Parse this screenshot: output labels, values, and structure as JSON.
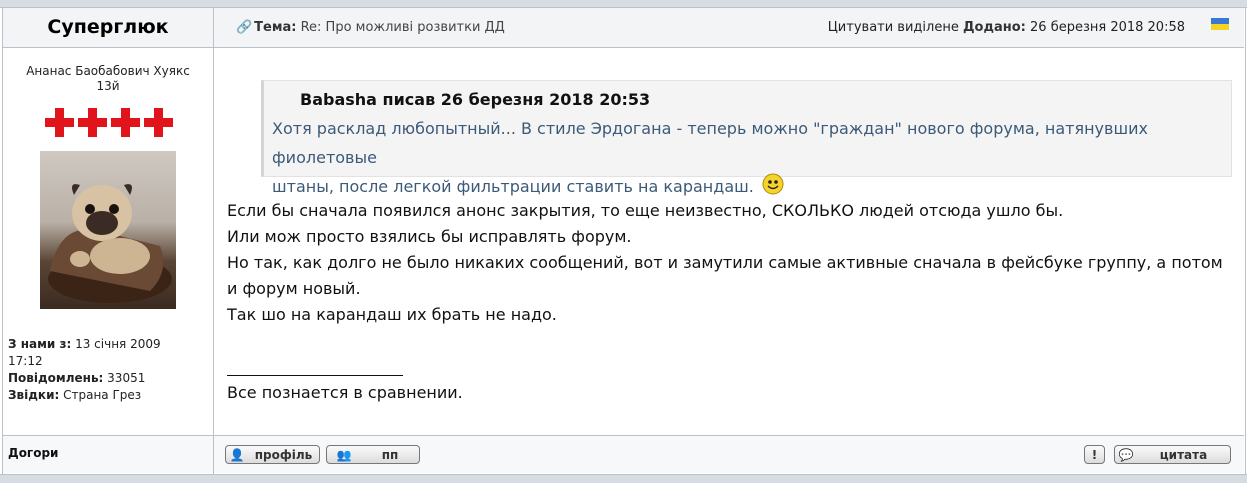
{
  "post": {
    "author_title": "Суперглюк",
    "topic_label": "Тема:",
    "topic_value": "Re: Про можливі розвитки ДД",
    "quote_selected": "Цитувати виділене",
    "added_label": "Додано:",
    "added_value": "26 березня 2018 20:58"
  },
  "user": {
    "name_line1": "Ананас Баобабович Хуякс",
    "name_line2": "13й",
    "joined_label": "З нами з:",
    "joined_value_line1": "13 січня 2009",
    "joined_value_line2": "17:12",
    "posts_label": "Повідомлень:",
    "posts_value": "33051",
    "from_label": "Звідки:",
    "from_value": "Страна Грез",
    "rank_icons": [
      "cross-icon",
      "cross-icon",
      "cross-icon",
      "cross-icon"
    ],
    "rank_color": "#e2141b"
  },
  "quote": {
    "author": "Babasha писав 26 березня 2018 20:53",
    "line1": "Хотя расклад любопытный... В стиле Эрдогана - теперь можно \"граждан\" нового форума, натянувших фиолетовые",
    "line2": "штаны, после легкой фильтрации ставить на карандаш.",
    "emoji": "smiley-icon"
  },
  "body": {
    "lines": [
      "Если бы сначала появился анонс закрытия, то еще неизвестно, СКОЛЬКО людей отсюда ушло бы.",
      "Или мож просто взялись бы исправлять форум.",
      "Но так, как долго не было никаких сообщений, вот и замутили самые активные сначала в фейсбуке группу, а потом",
      "и форум новый.",
      "Так шо на карандаш их брать не надо."
    ],
    "signature": "Все познается в сравнении."
  },
  "footer": {
    "to_top": "Догори",
    "profile_btn": "профіль",
    "pm_btn": "пп",
    "quote_btn": "цитата",
    "report_btn": "!"
  }
}
